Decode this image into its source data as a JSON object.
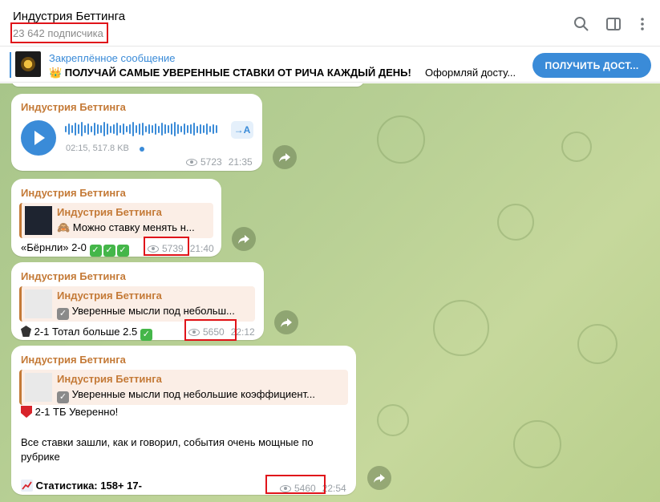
{
  "header": {
    "title": "Индустрия Беттинга",
    "subscribers": "23 642 подписчика",
    "icons": [
      "search-icon",
      "sidebar-toggle-icon",
      "more-vertical-icon"
    ]
  },
  "pinned": {
    "title": "Закреплённое сообщение",
    "text": "👑 ПОЛУЧАЙ САМЫЕ УВЕРЕННЫЕ СТАВКИ ОТ РИЧА КАЖДЫЙ ДЕНЬ!",
    "text2": "Оформляй досту...",
    "button": "ПОЛУЧИТЬ ДОСТ..."
  },
  "messages": [
    {
      "author": "Индустрия Беттинга",
      "voice_info": "02:15, 517.8 KB",
      "transcribe": "→A",
      "views": "5723",
      "time": "21:35"
    },
    {
      "author": "Индустрия Беттинга",
      "reply_author": "Индустрия Беттинга",
      "reply_text": "🙈 Можно ставку менять н...",
      "text": "«Бёрнли» 2-0",
      "views": "5739",
      "time": "21:40"
    },
    {
      "author": "Индустрия Беттинга",
      "reply_author": "Индустрия Беттинга",
      "reply_text": "Уверенные мысли под небольш...",
      "text": "2-1 Тотал больше 2.5",
      "views": "5650",
      "time": "22:12"
    },
    {
      "author": "Индустрия Беттинга",
      "reply_author": "Индустрия Беттинга",
      "reply_text": "Уверенные мысли под небольшие коэффициент...",
      "line1": "2-1 ТБ Уверенно!",
      "line2": "Все ставки зашли, как и говорил, события очень мощные по",
      "line3": "рубрике",
      "stats": "Статистика: 158+ 17-",
      "views": "5460",
      "time": "22:54"
    }
  ],
  "colors": {
    "accent": "#3a8bd8",
    "author": "#c47a37",
    "highlight": "#e0141a"
  }
}
